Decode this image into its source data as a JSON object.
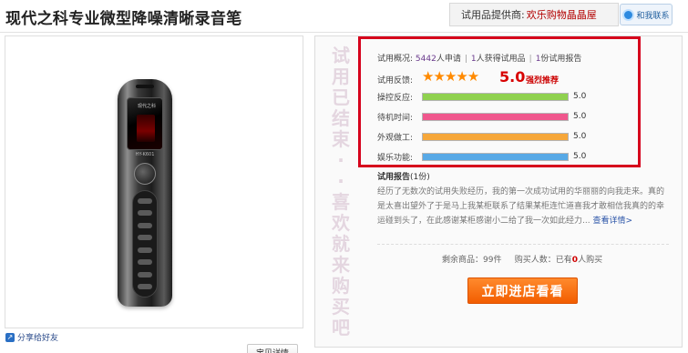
{
  "product": {
    "title": "现代之科专业微型降噪清晰录音笔",
    "brand_on_device": "现代之科",
    "model_on_device": "HY-K601"
  },
  "header": {
    "provider_label": "试用品提供商:",
    "provider_shop": "欢乐购物晶晶屋",
    "contact_label": "和我联系"
  },
  "image_panel": {
    "detail_button": "宝贝详情",
    "share_label": "分享给好友"
  },
  "status_vertical": [
    "试",
    "用",
    "已",
    "结",
    "束",
    "·",
    "·",
    "喜",
    "欢",
    "就",
    "来",
    "购",
    "买",
    "吧"
  ],
  "overview": {
    "label": "试用概况:",
    "applicants": "5442",
    "applicants_suffix": "人申请",
    "winners": "1",
    "winners_suffix": "人获得试用品",
    "reports": "1",
    "reports_suffix": "份试用报告"
  },
  "feedback": {
    "label": "试用反馈:",
    "stars": "★★★★★",
    "star_value": 5,
    "score": "5.0",
    "recommend": "强烈推荐"
  },
  "ratings": [
    {
      "label": "操控反应:",
      "value": "5.0",
      "fraction": 1.0,
      "color": "#8fd14f"
    },
    {
      "label": "待机时间:",
      "value": "5.0",
      "fraction": 1.0,
      "color": "#f0578d"
    },
    {
      "label": "外观做工:",
      "value": "5.0",
      "fraction": 1.0,
      "color": "#f6a73a"
    },
    {
      "label": "娱乐功能:",
      "value": "5.0",
      "fraction": 1.0,
      "color": "#58a9e6"
    }
  ],
  "report": {
    "title": "试用报告",
    "count": "(1份)",
    "text": "经历了无数次的试用失败经历，我的第一次成功试用的华丽丽的向我走来。真的是太喜出望外了于是马上我某柜联系了结果某柜连忙道喜我才敢相信我真的的幸运碰到头了，在此感谢某柜感谢小二给了我一次如此经力...",
    "more": "查看详情>"
  },
  "stock": {
    "remain_label": "剩余商品：",
    "remain_value": "99件",
    "bought_label": "购买人数：已有",
    "bought_value": "0",
    "bought_suffix": "人购买"
  },
  "buy_button": "立即进店看看",
  "colors": {
    "accent_red": "#d6001c",
    "button_orange": "#f25d00",
    "star_orange": "#ff8a00"
  }
}
